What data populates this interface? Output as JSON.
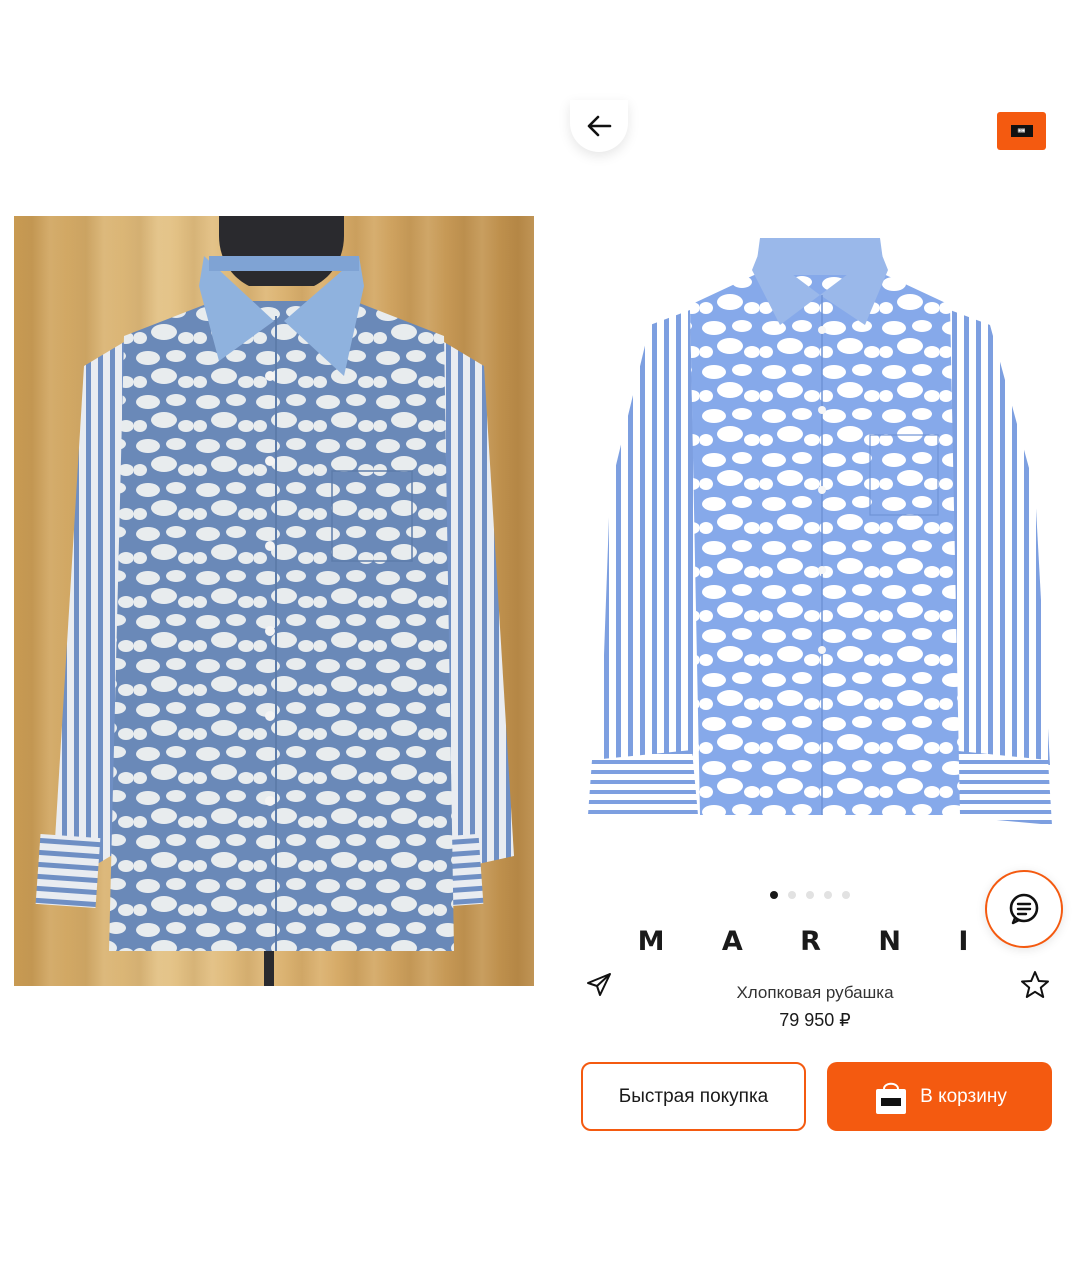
{
  "product": {
    "brand": "M A R N I",
    "name": "Хлопковая рубашка",
    "price": "79 950 ₽"
  },
  "gallery": {
    "dot_count": 5,
    "active_index": 0
  },
  "actions": {
    "quick_buy_label": "Быстрая покупка",
    "add_to_cart_label": "В корзину"
  },
  "icons": {
    "back": "arrow-left-icon",
    "cart": "shopping-bag-icon",
    "chat": "chat-icon",
    "share": "paper-plane-icon",
    "favorite": "star-icon"
  },
  "colors": {
    "accent": "#f45a10",
    "shirt_blue": "#8fb0e6",
    "stripe_blue": "#7d9fe0"
  }
}
